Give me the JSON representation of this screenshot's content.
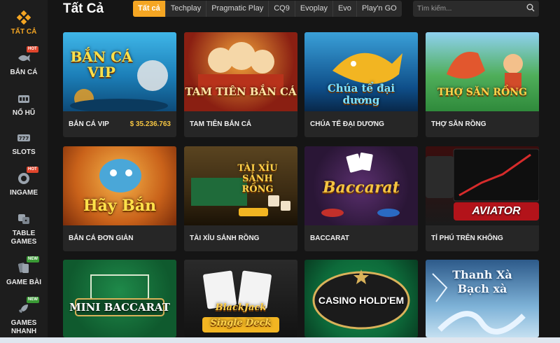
{
  "header": {
    "title": "Tất Cả",
    "tabs": [
      "Tất cả",
      "Techplay",
      "Pragmatic Play",
      "CQ9",
      "Evoplay",
      "Evo",
      "Play'n GO"
    ],
    "search_placeholder": "Tìm kiếm..."
  },
  "sidebar": {
    "items": [
      {
        "label": "TẤT CẢ",
        "icon": "grid-icon",
        "active": true,
        "badge": ""
      },
      {
        "label": "BẮN CÁ",
        "icon": "fish-icon",
        "active": false,
        "badge": "HOT"
      },
      {
        "label": "NỔ HŨ",
        "icon": "slot-machine-icon",
        "active": false,
        "badge": ""
      },
      {
        "label": "SLOTS",
        "icon": "slots-icon",
        "active": false,
        "badge": ""
      },
      {
        "label": "INGAME",
        "icon": "chip-icon",
        "active": false,
        "badge": "HOT"
      },
      {
        "label": "TABLE GAMES",
        "icon": "dice-icon",
        "active": false,
        "badge": ""
      },
      {
        "label": "GAME BÀI",
        "icon": "cards-icon",
        "active": false,
        "badge": "NEW"
      },
      {
        "label": "GAMES NHANH",
        "icon": "rocket-icon",
        "active": false,
        "badge": "NEW"
      }
    ]
  },
  "games": [
    {
      "name": "BẮN CÁ VIP",
      "jackpot": "35.236.763",
      "art_text": "BẮN CÁ VIP",
      "bg": "#1c7fb8"
    },
    {
      "name": "TAM TIÊN BẮN CÁ",
      "jackpot": "",
      "art_text": "TAM TIÊN BẮN CÁ",
      "bg": "#8a1f12"
    },
    {
      "name": "CHÚA TỂ ĐẠI DƯƠNG",
      "jackpot": "",
      "art_text": "Chúa tể đại dương",
      "bg": "#0f4f8a"
    },
    {
      "name": "THỢ SĂN RỒNG",
      "jackpot": "",
      "art_text": "THỢ SĂN RỒNG",
      "bg": "#2f8a3b"
    },
    {
      "name": "BẮN CÁ ĐƠN GIẢN",
      "jackpot": "",
      "art_text": "Hãy Bắn",
      "bg": "#c9621a"
    },
    {
      "name": "TÀI XỈU SẢNH RỒNG",
      "jackpot": "",
      "art_text": "TÀI XỈU SẢNH RỒNG",
      "bg": "#3a2a12"
    },
    {
      "name": "BACCARAT",
      "jackpot": "",
      "art_text": "Baccarat",
      "bg": "#2a1636"
    },
    {
      "name": "TỈ PHÚ TRÊN KHÔNG",
      "jackpot": "",
      "art_text": "AVIATOR",
      "bg": "#1a1a1a"
    },
    {
      "name": "",
      "jackpot": "",
      "art_text": "MINI BACCARAT",
      "bg": "#0f5a2e"
    },
    {
      "name": "",
      "jackpot": "",
      "art_text": "BlackJack Single Deck",
      "bg": "#1c1c1c"
    },
    {
      "name": "",
      "jackpot": "",
      "art_text": "CASINO HOLD'EM",
      "bg": "#0d6a3a"
    },
    {
      "name": "",
      "jackpot": "",
      "art_text": "Thanh Xà Bạch xà",
      "bg": "#2d5a8a"
    }
  ],
  "colors": {
    "accent": "#f5a623",
    "hot": "#e0452c",
    "new": "#3a9a35"
  }
}
